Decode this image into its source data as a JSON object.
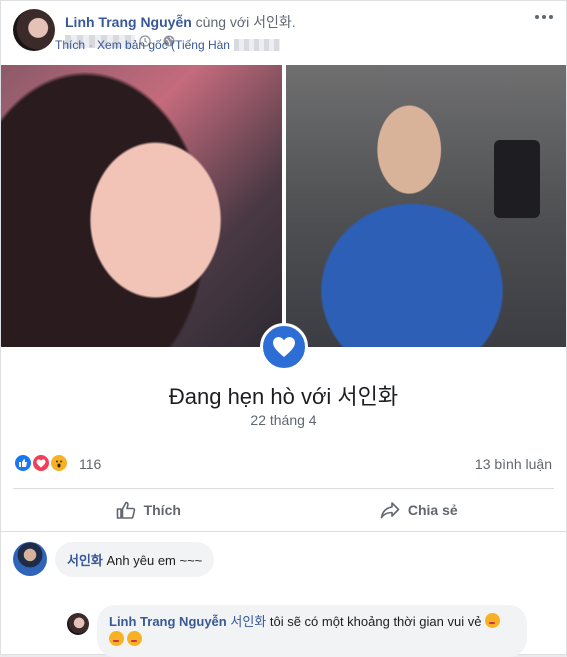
{
  "post": {
    "author": "Linh Trang Nguyễn",
    "with_text": " cùng với ",
    "tagged": "서인화",
    "tagged_suffix": "."
  },
  "life_event": {
    "title": "Đang hẹn hò với 서인화",
    "date": "22 tháng 4"
  },
  "stats": {
    "reaction_count": "116",
    "comment_count": "13 bình luận",
    "reactions": [
      "like-icon",
      "love-icon",
      "wow-icon"
    ]
  },
  "actions": {
    "like_label": "Thích",
    "share_label": "Chia sẻ"
  },
  "comment": {
    "author": "서인화",
    "text": "Anh yêu em ~~~",
    "like_link": "Thích",
    "separator": "·",
    "see_original": "Xem bản gốc (Tiếng Hàn"
  },
  "reply": {
    "author": "Linh Trang Nguyễn",
    "tag": "서인화",
    "text": "tôi sẽ có một khoảng thời gian vui vẻ"
  },
  "colors": {
    "link_blue": "#385898",
    "badge_blue": "#2d6ed6",
    "muted": "#606770"
  }
}
